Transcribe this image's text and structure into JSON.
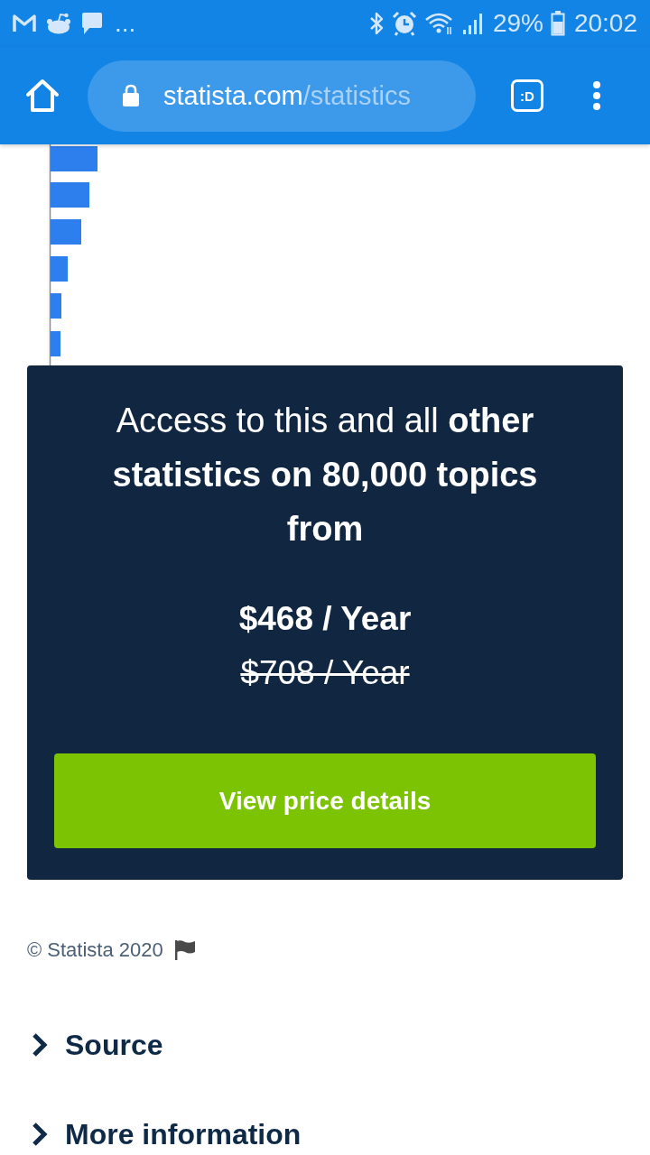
{
  "status_bar": {
    "notification_overflow": "...",
    "battery_percent": "29%",
    "time": "20:02"
  },
  "browser_toolbar": {
    "url_host": "statista.com",
    "url_path": "/statistics",
    "tab_switcher_label": ":D"
  },
  "paywall": {
    "message": "Access to this and all **other statistics on 80,000 topics from**",
    "price": "$468 / Year",
    "old_price": "$708 / Year",
    "button": "View price details"
  },
  "copyright": "© Statista 2020",
  "sections": [
    {
      "title": "Source",
      "expanded": false
    },
    {
      "title": "More information",
      "expanded": false
    }
  ]
}
